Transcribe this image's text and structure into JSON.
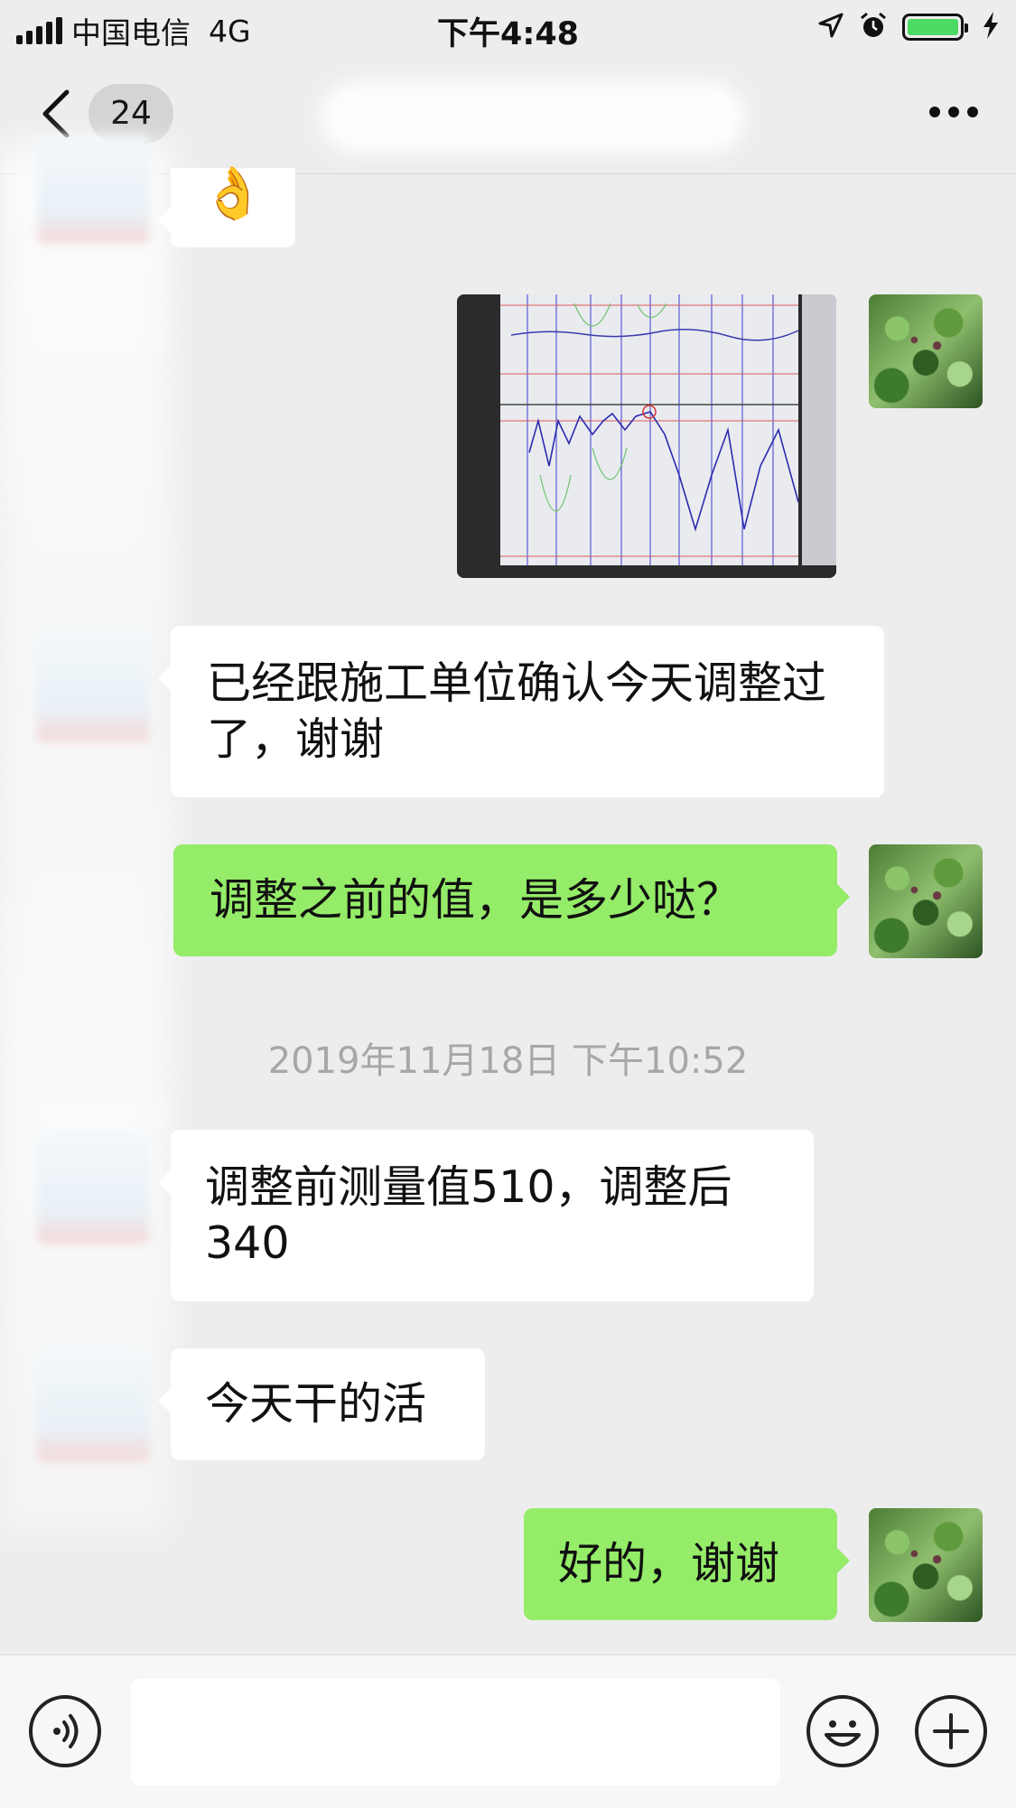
{
  "status_bar": {
    "carrier": "中国电信",
    "network": "4G",
    "time": "下午4:48"
  },
  "nav": {
    "unread_count": "24"
  },
  "messages": {
    "emoji_reply": "👌",
    "left_1": "已经跟施工单位确认今天调整过了，谢谢",
    "right_1": "调整之前的值，是多少哒？",
    "timestamp": "2019年11月18日 下午10:52",
    "left_2": "调整前测量值510，调整后340",
    "left_3": "今天干的活",
    "right_2": "好的，谢谢"
  },
  "colors": {
    "sent_bubble": "#95ec69",
    "received_bubble": "#ffffff",
    "background": "#ededed"
  },
  "icons": [
    "signal-icon",
    "location-arrow-icon",
    "alarm-icon",
    "battery-icon",
    "charging-icon",
    "back-icon",
    "more-icon",
    "voice-icon",
    "emoji-icon",
    "plus-icon"
  ]
}
